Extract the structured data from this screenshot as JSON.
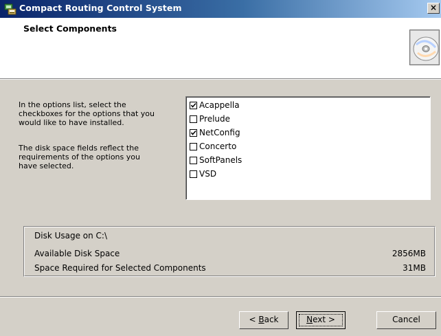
{
  "window": {
    "title": "Compact Routing Control System",
    "close_glyph": "×",
    "icon": "installer-app-icon"
  },
  "header": {
    "title": "Select Components",
    "icon": "cd-disc-icon"
  },
  "description": {
    "line1": "In the options list, select the",
    "line2": "checkboxes for the options that you",
    "line3": "would like to have installed.",
    "line4": "The disk space fields reflect the",
    "line5": "requirements of the options you",
    "line6": "have selected."
  },
  "options": [
    {
      "label": "Acappella",
      "checked": true
    },
    {
      "label": "Prelude",
      "checked": false
    },
    {
      "label": "NetConfig",
      "checked": true
    },
    {
      "label": "Concerto",
      "checked": false
    },
    {
      "label": "SoftPanels",
      "checked": false
    },
    {
      "label": "VSD",
      "checked": false
    }
  ],
  "disk": {
    "heading": "Disk Usage on C:\\",
    "available_label": "Available Disk Space",
    "available_value": "2856MB",
    "required_label": "Space Required for Selected Components",
    "required_value": "31MB"
  },
  "buttons": {
    "back_prefix": "< ",
    "back_access": "B",
    "back_rest": "ack",
    "next_access": "N",
    "next_rest": "ext >",
    "cancel": "Cancel"
  },
  "colors": {
    "face": "#d4d0c8",
    "title_start": "#0a246a",
    "title_end": "#a6caf0"
  }
}
